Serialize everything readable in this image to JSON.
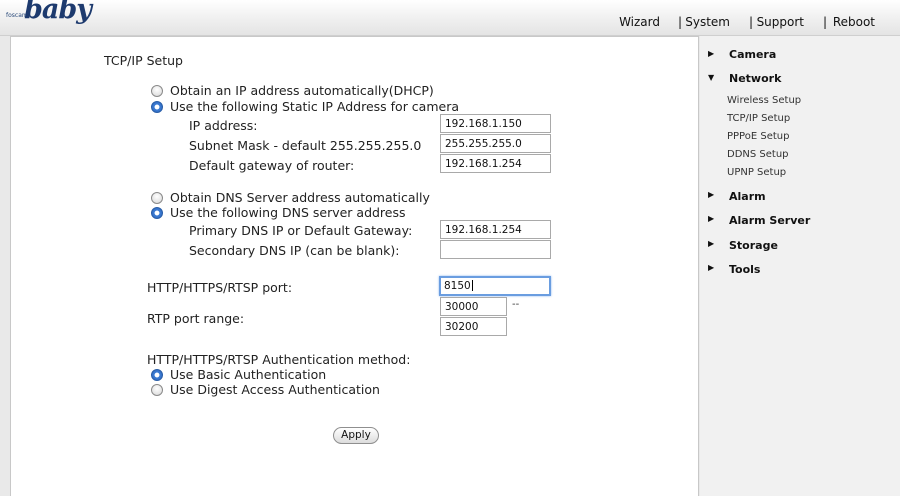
{
  "header": {
    "logo_small": "foscam",
    "logo_text": "baby",
    "nav": [
      "Wizard",
      "System",
      "Support",
      "Reboot"
    ],
    "separator": "|"
  },
  "form": {
    "title": "TCP/IP Setup",
    "ip_mode": {
      "dhcp_label": "Obtain an IP address automatically(DHCP)",
      "static_label": "Use the following Static IP Address for camera",
      "selected": "static"
    },
    "ip_address": {
      "label": "IP address:",
      "value": "192.168.1.150"
    },
    "subnet_mask": {
      "label": "Subnet Mask - default 255.255.255.0",
      "value": "255.255.255.0"
    },
    "gateway": {
      "label": "Default gateway of router:",
      "value": "192.168.1.254"
    },
    "dns_mode": {
      "auto_label": "Obtain DNS Server address automatically",
      "manual_label": "Use the following DNS server address",
      "selected": "manual"
    },
    "primary_dns": {
      "label": "Primary DNS IP or Default Gateway:",
      "value": "192.168.1.254"
    },
    "secondary_dns": {
      "label": "Secondary DNS IP (can be blank):",
      "value": ""
    },
    "http_port": {
      "label": "HTTP/HTTPS/RTSP port:",
      "value": "8150"
    },
    "rtp_range": {
      "label": "RTP port range:",
      "start": "30000",
      "separator": "--",
      "end": "30200"
    },
    "auth": {
      "label": "HTTP/HTTPS/RTSP Authentication method:",
      "basic_label": "Use Basic Authentication",
      "digest_label": "Use Digest Access Authentication",
      "selected": "basic"
    },
    "apply_label": "Apply"
  },
  "sidebar": {
    "expand_icon": "triangle-right-icon",
    "collapse_icon": "triangle-down-icon",
    "sections": [
      {
        "label": "Camera",
        "expanded": false
      },
      {
        "label": "Network",
        "expanded": true,
        "items": [
          "Wireless Setup",
          "TCP/IP Setup",
          "PPPoE Setup",
          "DDNS Setup",
          "UPNP Setup"
        ]
      },
      {
        "label": "Alarm",
        "expanded": false
      },
      {
        "label": "Alarm Server",
        "expanded": false
      },
      {
        "label": "Storage",
        "expanded": false
      },
      {
        "label": "Tools",
        "expanded": false
      }
    ]
  }
}
